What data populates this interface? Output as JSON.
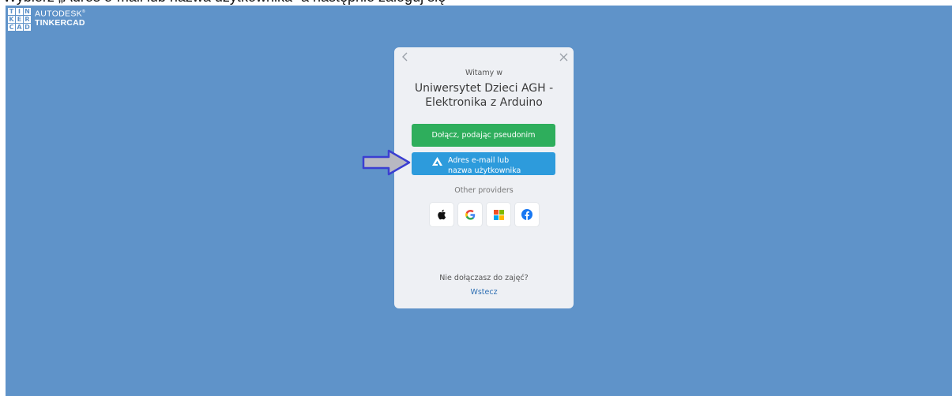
{
  "caption": {
    "text": "Wybierz „Adres e-mail lub nazwa użytkownika” a następnie zaloguj się"
  },
  "logo": {
    "letters": [
      "T",
      "I",
      "N",
      "K",
      "E",
      "R",
      "C",
      "A",
      "D"
    ],
    "brand": "AUTODESK",
    "trademark": "®",
    "product": "TINKERCAD"
  },
  "modal": {
    "welcome": "Witamy w",
    "class_line1": "Uniwersytet Dzieci AGH -",
    "class_line2": "Elektronika z Arduino",
    "nickname_button": "Dołącz, podając pseudonim",
    "email_button": "Adres e-mail lub nazwa użytkownika",
    "providers_label": "Other providers",
    "providers": [
      "apple-icon",
      "google-icon",
      "microsoft-icon",
      "facebook-icon"
    ],
    "not_joining": "Nie dołączasz do zajęć?",
    "back_link": "Wstecz"
  },
  "colors": {
    "background": "#5f93c9",
    "modal": "#eef0f4",
    "nickname_button": "#2eae5c",
    "email_button": "#2d9bdc",
    "link": "#2f6fb3",
    "arrow_fill": "#b8b8c2",
    "arrow_stroke": "#3b3fd1"
  }
}
